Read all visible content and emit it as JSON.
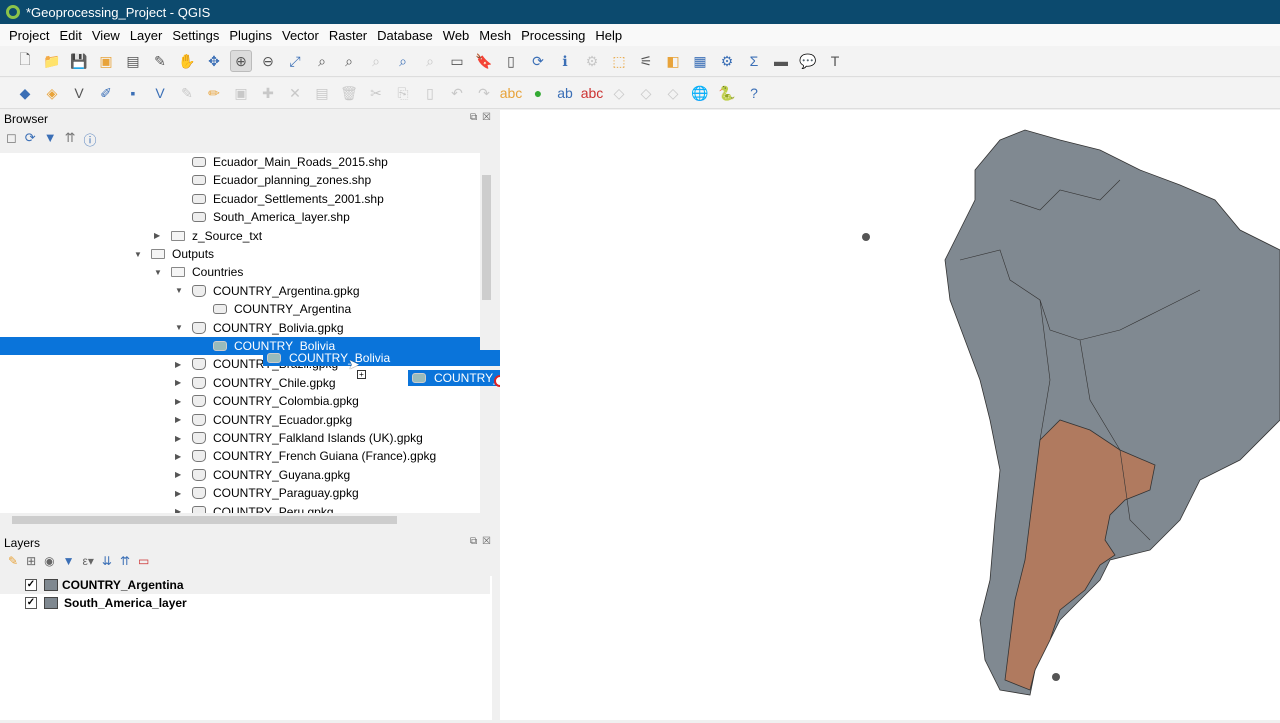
{
  "window": {
    "title": "*Geoprocessing_Project - QGIS"
  },
  "menu": [
    "Project",
    "Edit",
    "View",
    "Layer",
    "Settings",
    "Plugins",
    "Vector",
    "Raster",
    "Database",
    "Web",
    "Mesh",
    "Processing",
    "Help"
  ],
  "browser": {
    "title": "Browser",
    "items": [
      {
        "label": "Ecuador_Main_Roads_2015.shp",
        "level": 3,
        "type": "layer",
        "arrow": ""
      },
      {
        "label": "Ecuador_planning_zones.shp",
        "level": 3,
        "type": "layer",
        "arrow": ""
      },
      {
        "label": "Ecuador_Settlements_2001.shp",
        "level": 3,
        "type": "layer",
        "arrow": ""
      },
      {
        "label": "South_America_layer.shp",
        "level": 3,
        "type": "layer",
        "arrow": ""
      },
      {
        "label": "z_Source_txt",
        "level": 2,
        "type": "folder",
        "arrow": "▶"
      },
      {
        "label": "Outputs",
        "level": 1,
        "type": "folder",
        "arrow": "▼"
      },
      {
        "label": "Countries",
        "level": 2,
        "type": "folder",
        "arrow": "▼"
      },
      {
        "label": "COUNTRY_Argentina.gpkg",
        "level": 3,
        "type": "db",
        "arrow": "▼"
      },
      {
        "label": "COUNTRY_Argentina",
        "level": 4,
        "type": "layer",
        "arrow": ""
      },
      {
        "label": "COUNTRY_Bolivia.gpkg",
        "level": 3,
        "type": "db",
        "arrow": "▼"
      },
      {
        "label": "COUNTRY_Bolivia",
        "level": 4,
        "type": "layer",
        "arrow": "",
        "selected": true
      },
      {
        "label": "COUNTRY_Brazil.gpkg",
        "level": 3,
        "type": "db",
        "arrow": "▶"
      },
      {
        "label": "COUNTRY_Chile.gpkg",
        "level": 3,
        "type": "db",
        "arrow": "▶"
      },
      {
        "label": "COUNTRY_Colombia.gpkg",
        "level": 3,
        "type": "db",
        "arrow": "▶"
      },
      {
        "label": "COUNTRY_Ecuador.gpkg",
        "level": 3,
        "type": "db",
        "arrow": "▶"
      },
      {
        "label": "COUNTRY_Falkland Islands (UK).gpkg",
        "level": 3,
        "type": "db",
        "arrow": "▶"
      },
      {
        "label": "COUNTRY_French Guiana (France).gpkg",
        "level": 3,
        "type": "db",
        "arrow": "▶"
      },
      {
        "label": "COUNTRY_Guyana.gpkg",
        "level": 3,
        "type": "db",
        "arrow": "▶"
      },
      {
        "label": "COUNTRY_Paraguay.gpkg",
        "level": 3,
        "type": "db",
        "arrow": "▶"
      },
      {
        "label": "COUNTRY_Peru.gpkg",
        "level": 3,
        "type": "db",
        "arrow": "▶"
      }
    ]
  },
  "drag": {
    "label1": "COUNTRY_Bolivia",
    "label2": "COUNTRY_Bolivia"
  },
  "layers": {
    "title": "Layers",
    "items": [
      {
        "label": "COUNTRY_Argentina",
        "checked": true,
        "color": "#7f8890"
      },
      {
        "label": "South_America_layer",
        "checked": true,
        "color": "#7f8890"
      }
    ]
  },
  "colors": {
    "selection": "#0a74da",
    "land": "#808991",
    "argentina": "#b07a5f",
    "titlebar": "#0c4a6e"
  }
}
